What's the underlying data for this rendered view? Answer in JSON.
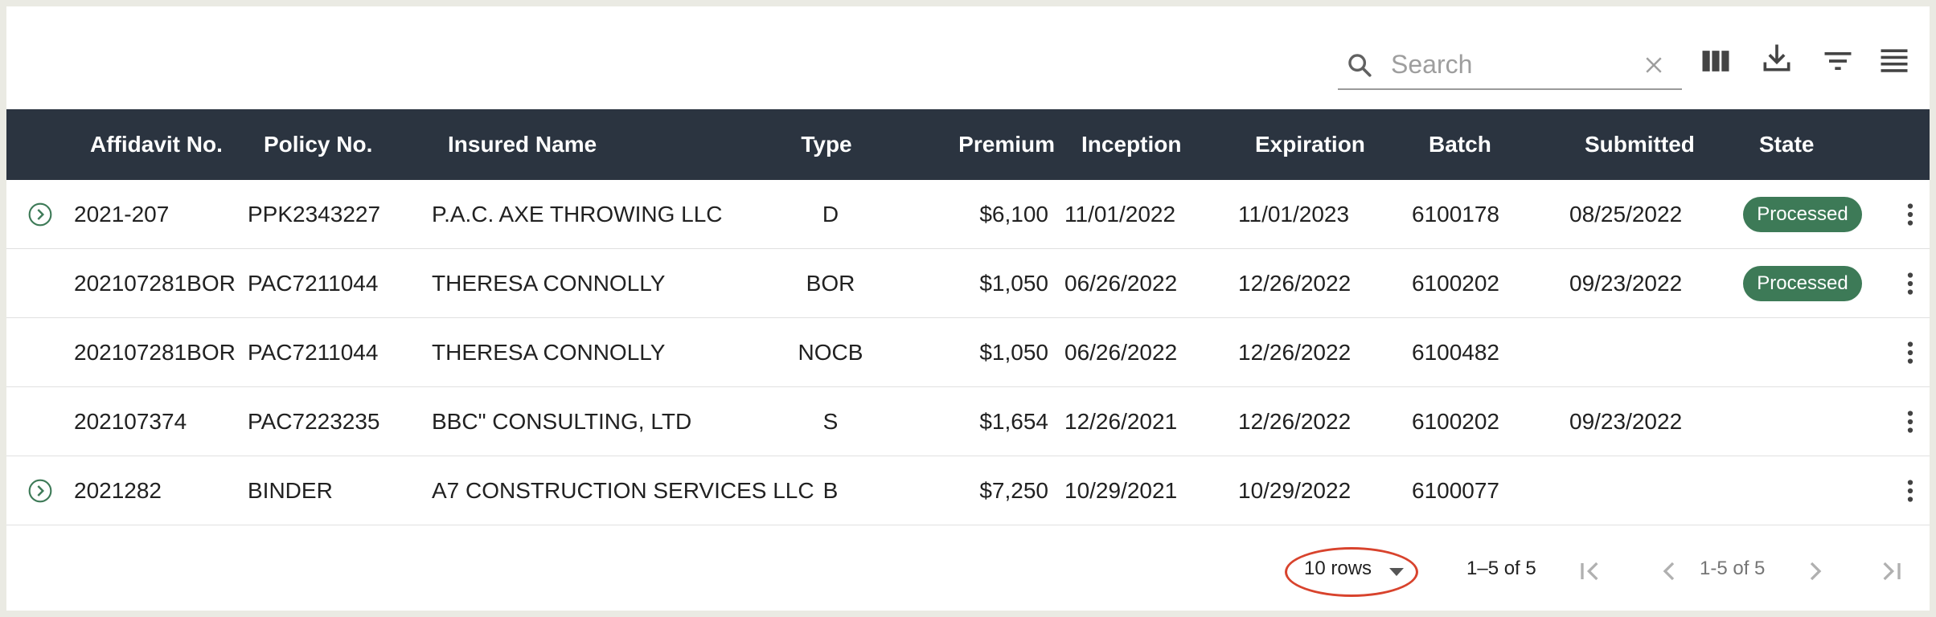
{
  "search": {
    "placeholder": "Search",
    "value": ""
  },
  "toolbar": {
    "icons": [
      "columns-icon",
      "download-icon",
      "filter-icon",
      "density-icon"
    ]
  },
  "table": {
    "columns": [
      "Affidavit No.",
      "Policy No.",
      "Insured Name",
      "Type",
      "Premium",
      "Inception",
      "Expiration",
      "Batch",
      "Submitted",
      "State"
    ],
    "rows": [
      {
        "expandable": true,
        "affidavit": "2021-207",
        "policy": "PPK2343227",
        "insured": "P.A.C. AXE THROWING LLC",
        "type": "D",
        "premium": "$6,100",
        "inception": "11/01/2022",
        "expiration": "11/01/2023",
        "batch": "6100178",
        "submitted": "08/25/2022",
        "state": "Processed"
      },
      {
        "expandable": false,
        "affidavit": "202107281BOR",
        "policy": "PAC7211044",
        "insured": "THERESA CONNOLLY",
        "type": "BOR",
        "premium": "$1,050",
        "inception": "06/26/2022",
        "expiration": "12/26/2022",
        "batch": "6100202",
        "submitted": "09/23/2022",
        "state": "Processed"
      },
      {
        "expandable": false,
        "affidavit": "202107281BOR",
        "policy": "PAC7211044",
        "insured": "THERESA CONNOLLY",
        "type": "NOCB",
        "premium": "$1,050",
        "inception": "06/26/2022",
        "expiration": "12/26/2022",
        "batch": "6100482",
        "submitted": "",
        "state": ""
      },
      {
        "expandable": false,
        "affidavit": "202107374",
        "policy": "PAC7223235",
        "insured": "BBC\" CONSULTING, LTD",
        "type": "S",
        "premium": "$1,654",
        "inception": "12/26/2021",
        "expiration": "12/26/2022",
        "batch": "6100202",
        "submitted": "09/23/2022",
        "state": ""
      },
      {
        "expandable": true,
        "affidavit": "2021282",
        "policy": "BINDER",
        "insured": "A7 CONSTRUCTION SERVICES LLC",
        "type": "B",
        "premium": "$7,250",
        "inception": "10/29/2021",
        "expiration": "10/29/2022",
        "batch": "6100077",
        "submitted": "",
        "state": ""
      }
    ]
  },
  "pagination": {
    "rows_per_page": "10 rows",
    "range": "1–5 of 5",
    "page_range": "1-5 of 5"
  },
  "colors": {
    "header_bg": "#2b3440",
    "badge_bg": "#3d7a57",
    "highlight_oval": "#d8432d",
    "page_bg": "#eaeae3"
  }
}
